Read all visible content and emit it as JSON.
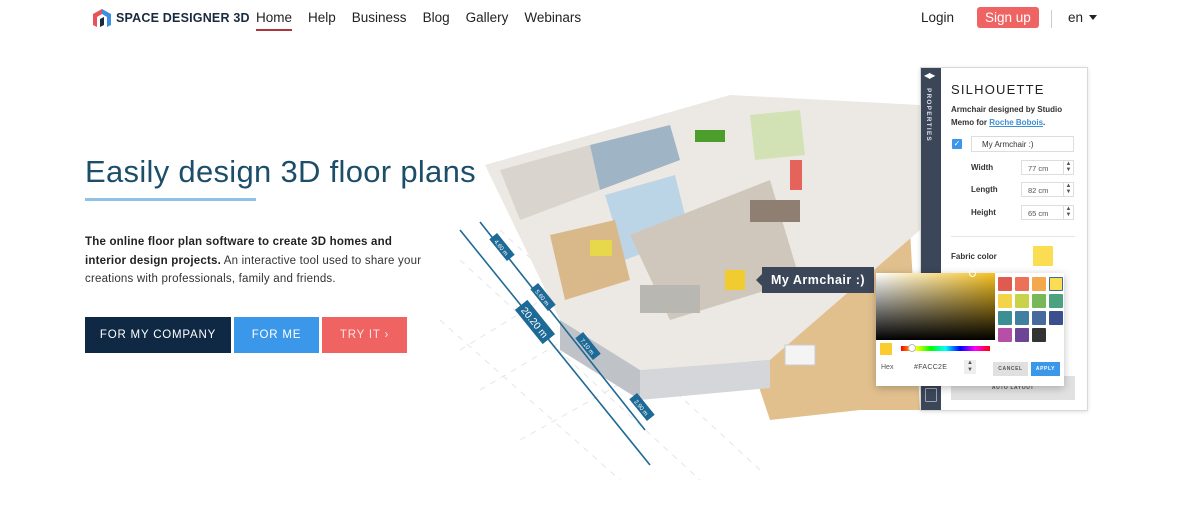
{
  "nav": {
    "brand": "SPACE DESIGNER 3D",
    "links": [
      {
        "label": "Home",
        "active": true
      },
      {
        "label": "Help",
        "active": false
      },
      {
        "label": "Business",
        "active": false
      },
      {
        "label": "Blog",
        "active": false
      },
      {
        "label": "Gallery",
        "active": false
      },
      {
        "label": "Webinars",
        "active": false
      }
    ],
    "login": "Login",
    "signup": "Sign up",
    "language": "en"
  },
  "hero": {
    "title": "Easily design 3D floor plans",
    "desc_bold": "The online floor plan software to create 3D homes and interior design projects.",
    "desc_rest": " An interactive tool used to share your creations with professionals, family and friends.",
    "buttons": {
      "company": "FOR MY COMPANY",
      "me": "FOR ME",
      "try": "TRY IT ›"
    }
  },
  "illustration": {
    "total_dimension": "20.20 m",
    "segment_dimensions": [
      "4.60 m",
      "5.60 m",
      "7.10 m",
      "2.90 m"
    ],
    "tooltip": "My Armchair :)"
  },
  "properties_panel": {
    "strip_label": "PROPERTIES",
    "title": "SILHOUETTE",
    "desc_prefix": "Armchair designed by Studio Memo for ",
    "desc_link": "Roche Bobois",
    "desc_suffix": ".",
    "name_value": "My Armchair :)",
    "fields": [
      {
        "label": "Width",
        "value": "77 cm"
      },
      {
        "label": "Length",
        "value": "82 cm"
      },
      {
        "label": "Height",
        "value": "65 cm"
      }
    ],
    "fabric_label": "Fabric color",
    "fabric_color": "#FADD53",
    "auto_layout": "AUTO LAYOUT"
  },
  "color_picker": {
    "hex_label": "Hex",
    "hex_value": "#FACC2E",
    "cancel": "CANCEL",
    "apply": "APPLY",
    "swatches": [
      "#e05a4f",
      "#ec7157",
      "#f4a84e",
      "#fadd53",
      "#f2d34a",
      "#c8d24a",
      "#78b85a",
      "#4aa37e",
      "#3a8f95",
      "#3f7fa0",
      "#466a9e",
      "#3a4f8e",
      "#b54fa8",
      "#6d4496",
      "#333333"
    ],
    "selected_swatch": 3
  }
}
